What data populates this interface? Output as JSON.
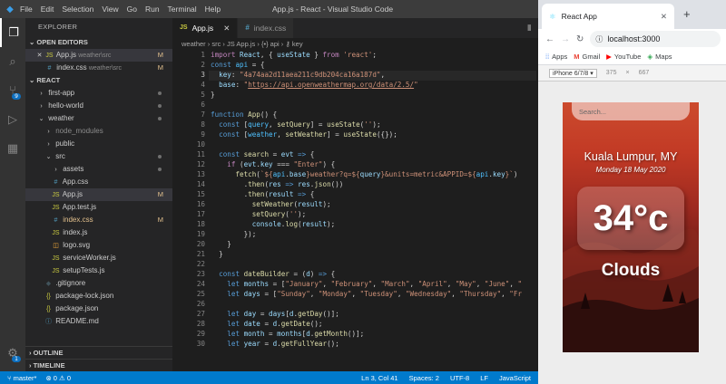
{
  "vscode": {
    "menu": [
      "File",
      "Edit",
      "Selection",
      "View",
      "Go",
      "Run",
      "Terminal",
      "Help"
    ],
    "window_title": "App.js - React - Visual Studio Code",
    "explorer_title": "EXPLORER",
    "open_editors_label": "OPEN EDITORS",
    "open_editors": [
      {
        "name": "App.js",
        "path": "weather\\src",
        "mark": "M",
        "close": "✕"
      },
      {
        "name": "index.css",
        "path": "weather\\src",
        "mark": "M"
      }
    ],
    "workspace_label": "REACT",
    "tree": [
      {
        "indent": 1,
        "type": "folder-closed",
        "name": "first-app",
        "dot": true
      },
      {
        "indent": 1,
        "type": "folder-closed",
        "name": "hello-world",
        "dot": true
      },
      {
        "indent": 1,
        "type": "folder-open",
        "name": "weather",
        "dot": true
      },
      {
        "indent": 2,
        "type": "folder-closed",
        "name": "node_modules",
        "dim": true
      },
      {
        "indent": 2,
        "type": "folder-closed",
        "name": "public"
      },
      {
        "indent": 2,
        "type": "folder-open",
        "name": "src",
        "dot": true
      },
      {
        "indent": 3,
        "type": "folder-closed",
        "name": "assets",
        "dot": true
      },
      {
        "indent": 3,
        "type": "css",
        "name": "App.css"
      },
      {
        "indent": 3,
        "type": "js",
        "name": "App.js",
        "mark": "M",
        "selected": true
      },
      {
        "indent": 3,
        "type": "js",
        "name": "App.test.js"
      },
      {
        "indent": 3,
        "type": "css",
        "name": "index.css",
        "mark": "M",
        "modified": true
      },
      {
        "indent": 3,
        "type": "js",
        "name": "index.js"
      },
      {
        "indent": 3,
        "type": "svg",
        "name": "logo.svg"
      },
      {
        "indent": 3,
        "type": "js",
        "name": "serviceWorker.js"
      },
      {
        "indent": 3,
        "type": "js",
        "name": "setupTests.js"
      },
      {
        "indent": 2,
        "type": "git",
        "name": ".gitignore"
      },
      {
        "indent": 2,
        "type": "json",
        "name": "package-lock.json"
      },
      {
        "indent": 2,
        "type": "json",
        "name": "package.json"
      },
      {
        "indent": 2,
        "type": "md",
        "name": "README.md"
      }
    ],
    "outline_label": "OUTLINE",
    "timeline_label": "TIMELINE",
    "tabs": [
      {
        "name": "App.js",
        "badge": "JS",
        "active": true,
        "close": "✕"
      },
      {
        "name": "index.css",
        "badge": "#",
        "active": false
      }
    ],
    "breadcrumb": "weather › src › JS App.js › {•} api › ⚷ key",
    "scm_badge": "9",
    "settings_badge": "1",
    "status": {
      "branch": "master*",
      "problems": "⊗ 0  ⚠ 0",
      "position": "Ln 3, Col 41",
      "spaces": "Spaces: 2",
      "encoding": "UTF-8",
      "eol": "LF",
      "language": "JavaScript"
    }
  },
  "browser": {
    "tab_title": "React App",
    "url": "localhost:3000",
    "bookmarks": [
      "Apps",
      "Gmail",
      "YouTube",
      "Maps"
    ],
    "device": "iPhone 6/7/8 ▾",
    "width": "375",
    "times": "×",
    "height": "667",
    "app": {
      "search_placeholder": "Search...",
      "location": "Kuala Lumpur, MY",
      "date": "Monday 18 May 2020",
      "temperature": "34°c",
      "weather": "Clouds"
    }
  }
}
